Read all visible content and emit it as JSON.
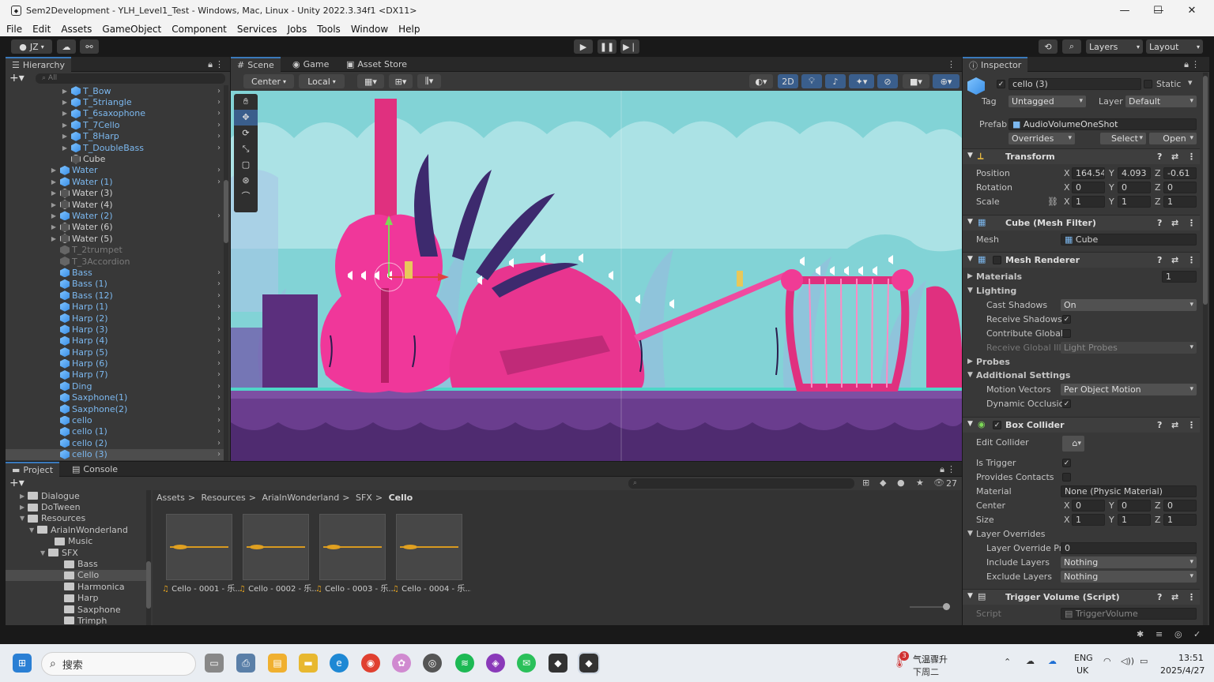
{
  "window": {
    "title": "Sem2Development - YLH_Level1_Test - Windows, Mac, Linux - Unity 2022.3.34f1 <DX11>",
    "minimize": "—",
    "maximize": "☐",
    "close": "✕"
  },
  "menu": [
    "File",
    "Edit",
    "Assets",
    "GameObject",
    "Component",
    "Services",
    "Jobs",
    "Tools",
    "Window",
    "Help"
  ],
  "toolbar": {
    "account": "JZ",
    "layers": "Layers",
    "layout": "Layout"
  },
  "hierarchy": {
    "title": "Hierarchy",
    "search_placeholder": "All",
    "rows": [
      {
        "label": "T_Bow",
        "style": "blue",
        "indent": 70,
        "arrow": "▶",
        "chev": true
      },
      {
        "label": "T_5triangle",
        "style": "blue",
        "indent": 70,
        "arrow": "▶",
        "chev": true
      },
      {
        "label": "T_6saxophone",
        "style": "blue",
        "indent": 70,
        "arrow": "▶",
        "chev": true
      },
      {
        "label": "T_7Cello",
        "style": "blue",
        "indent": 70,
        "arrow": "▶",
        "chev": true
      },
      {
        "label": "T_8Harp",
        "style": "blue",
        "indent": 70,
        "arrow": "▶",
        "chev": true
      },
      {
        "label": "T_DoubleBass",
        "style": "blue",
        "indent": 70,
        "arrow": "▶",
        "chev": true
      },
      {
        "label": "Cube",
        "style": "white",
        "indent": 70,
        "arrow": "",
        "chev": false
      },
      {
        "label": "Water",
        "style": "blue",
        "indent": 56,
        "arrow": "▶",
        "chev": true
      },
      {
        "label": "Water (1)",
        "style": "blue",
        "indent": 56,
        "arrow": "▶",
        "chev": true
      },
      {
        "label": "Water (3)",
        "style": "white",
        "indent": 56,
        "arrow": "▶",
        "chev": false
      },
      {
        "label": "Water (4)",
        "style": "white",
        "indent": 56,
        "arrow": "▶",
        "chev": false
      },
      {
        "label": "Water (2)",
        "style": "blue",
        "indent": 56,
        "arrow": "▶",
        "chev": true
      },
      {
        "label": "Water (6)",
        "style": "white",
        "indent": 56,
        "arrow": "▶",
        "chev": false
      },
      {
        "label": "Water (5)",
        "style": "white",
        "indent": 56,
        "arrow": "▶",
        "chev": false
      },
      {
        "label": "T_2trumpet",
        "style": "dim",
        "indent": 56,
        "arrow": "",
        "chev": false
      },
      {
        "label": "T_3Accordion",
        "style": "dim",
        "indent": 56,
        "arrow": "",
        "chev": false
      },
      {
        "label": "Bass",
        "style": "blue",
        "indent": 56,
        "arrow": "",
        "chev": true
      },
      {
        "label": "Bass (1)",
        "style": "blue",
        "indent": 56,
        "arrow": "",
        "chev": true
      },
      {
        "label": "Bass (12)",
        "style": "blue",
        "indent": 56,
        "arrow": "",
        "chev": true
      },
      {
        "label": "Harp (1)",
        "style": "blue",
        "indent": 56,
        "arrow": "",
        "chev": true
      },
      {
        "label": "Harp (2)",
        "style": "blue",
        "indent": 56,
        "arrow": "",
        "chev": true
      },
      {
        "label": "Harp (3)",
        "style": "blue",
        "indent": 56,
        "arrow": "",
        "chev": true
      },
      {
        "label": "Harp (4)",
        "style": "blue",
        "indent": 56,
        "arrow": "",
        "chev": true
      },
      {
        "label": "Harp (5)",
        "style": "blue",
        "indent": 56,
        "arrow": "",
        "chev": true
      },
      {
        "label": "Harp (6)",
        "style": "blue",
        "indent": 56,
        "arrow": "",
        "chev": true
      },
      {
        "label": "Harp (7)",
        "style": "blue",
        "indent": 56,
        "arrow": "",
        "chev": true
      },
      {
        "label": "Ding",
        "style": "blue",
        "indent": 56,
        "arrow": "",
        "chev": true
      },
      {
        "label": "Saxphone(1)",
        "style": "blue",
        "indent": 56,
        "arrow": "",
        "chev": true
      },
      {
        "label": "Saxphone(2)",
        "style": "blue",
        "indent": 56,
        "arrow": "",
        "chev": true
      },
      {
        "label": "cello",
        "style": "blue",
        "indent": 56,
        "arrow": "",
        "chev": true
      },
      {
        "label": "cello (1)",
        "style": "blue",
        "indent": 56,
        "arrow": "",
        "chev": true
      },
      {
        "label": "cello (2)",
        "style": "blue",
        "indent": 56,
        "arrow": "",
        "chev": true
      },
      {
        "label": "cello (3)",
        "style": "blue sel",
        "indent": 56,
        "arrow": "",
        "chev": true
      }
    ]
  },
  "scene": {
    "tabs": [
      "Scene",
      "Game",
      "Asset Store"
    ],
    "pivot": "Center",
    "space": "Local",
    "mode2d": "2D"
  },
  "inspector": {
    "title": "Inspector",
    "object_name": "cello (3)",
    "static_label": "Static",
    "tag_label": "Tag",
    "tag": "Untagged",
    "layer_label": "Layer",
    "layer": "Default",
    "prefab_label": "Prefab",
    "prefab": "AudioVolumeOneShot",
    "overrides": "Overrides",
    "select": "Select",
    "open": "Open",
    "transform": {
      "title": "Transform",
      "position_label": "Position",
      "rotation_label": "Rotation",
      "scale_label": "Scale",
      "position": [
        "164.54",
        "4.093",
        "-0.61"
      ],
      "rotation": [
        "0",
        "0",
        "0"
      ],
      "scale": [
        "1",
        "1",
        "1"
      ]
    },
    "mesh_filter": {
      "title": "Cube (Mesh Filter)",
      "mesh_label": "Mesh",
      "mesh": "Cube"
    },
    "mesh_renderer": {
      "title": "Mesh Renderer",
      "materials_label": "Materials",
      "materials_count": "1",
      "lighting_label": "Lighting",
      "cast_shadows_label": "Cast Shadows",
      "cast_shadows": "On",
      "receive_shadows_label": "Receive Shadows",
      "contribute_global_label": "Contribute Global",
      "receive_global_label": "Receive Global Illu",
      "receive_global": "Light Probes",
      "probes_label": "Probes",
      "additional_label": "Additional Settings",
      "motion_vectors_label": "Motion Vectors",
      "motion_vectors": "Per Object Motion",
      "dynamic_occlusion_label": "Dynamic Occlusic"
    },
    "box_collider": {
      "title": "Box Collider",
      "edit_collider_label": "Edit Collider",
      "is_trigger_label": "Is Trigger",
      "provides_contacts_label": "Provides Contacts",
      "material_label": "Material",
      "material": "None (Physic Material)",
      "center_label": "Center",
      "center": [
        "0",
        "0",
        "0"
      ],
      "size_label": "Size",
      "size": [
        "1",
        "1",
        "1"
      ],
      "layer_overrides_label": "Layer Overrides",
      "layer_override_pri_label": "Layer Override Pri",
      "layer_override_pri": "0",
      "include_layers_label": "Include Layers",
      "include_layers": "Nothing",
      "exclude_layers_label": "Exclude Layers",
      "exclude_layers": "Nothing"
    },
    "trigger_volume": {
      "title": "Trigger Volume (Script)",
      "script_label": "Script",
      "script": "TriggerVolume"
    }
  },
  "project": {
    "tabs": [
      "Project",
      "Console"
    ],
    "tree": [
      {
        "label": "Dialogue",
        "indent": 18,
        "arrow": "▶"
      },
      {
        "label": "DoTween",
        "indent": 18,
        "arrow": "▶"
      },
      {
        "label": "Resources",
        "indent": 18,
        "arrow": "▼"
      },
      {
        "label": "ArialnWonderland",
        "indent": 30,
        "arrow": "▼"
      },
      {
        "label": "Music",
        "indent": 52,
        "arrow": ""
      },
      {
        "label": "SFX",
        "indent": 44,
        "arrow": "▼"
      },
      {
        "label": "Bass",
        "indent": 64,
        "arrow": ""
      },
      {
        "label": "Cello",
        "indent": 64,
        "arrow": "",
        "sel": true
      },
      {
        "label": "Harmonica",
        "indent": 64,
        "arrow": ""
      },
      {
        "label": "Harp",
        "indent": 64,
        "arrow": ""
      },
      {
        "label": "Saxphone",
        "indent": 64,
        "arrow": ""
      },
      {
        "label": "Trimph",
        "indent": 64,
        "arrow": ""
      }
    ],
    "breadcrumb": [
      "Assets",
      "Resources",
      "ArialnWonderland",
      "SFX",
      "Cello"
    ],
    "asset_count": "27",
    "assets": [
      "Cello - 0001 - 乐...",
      "Cello - 0002 - 乐...",
      "Cello - 0003 - 乐...",
      "Cello - 0004 - 乐..."
    ]
  },
  "taskbar": {
    "search": "搜索",
    "weather_temp": "气温骤升",
    "weather_sub": "下周二",
    "badge": "3",
    "lang": "ENG",
    "region": "UK",
    "time": "13:51",
    "date": "2025/4/27"
  }
}
